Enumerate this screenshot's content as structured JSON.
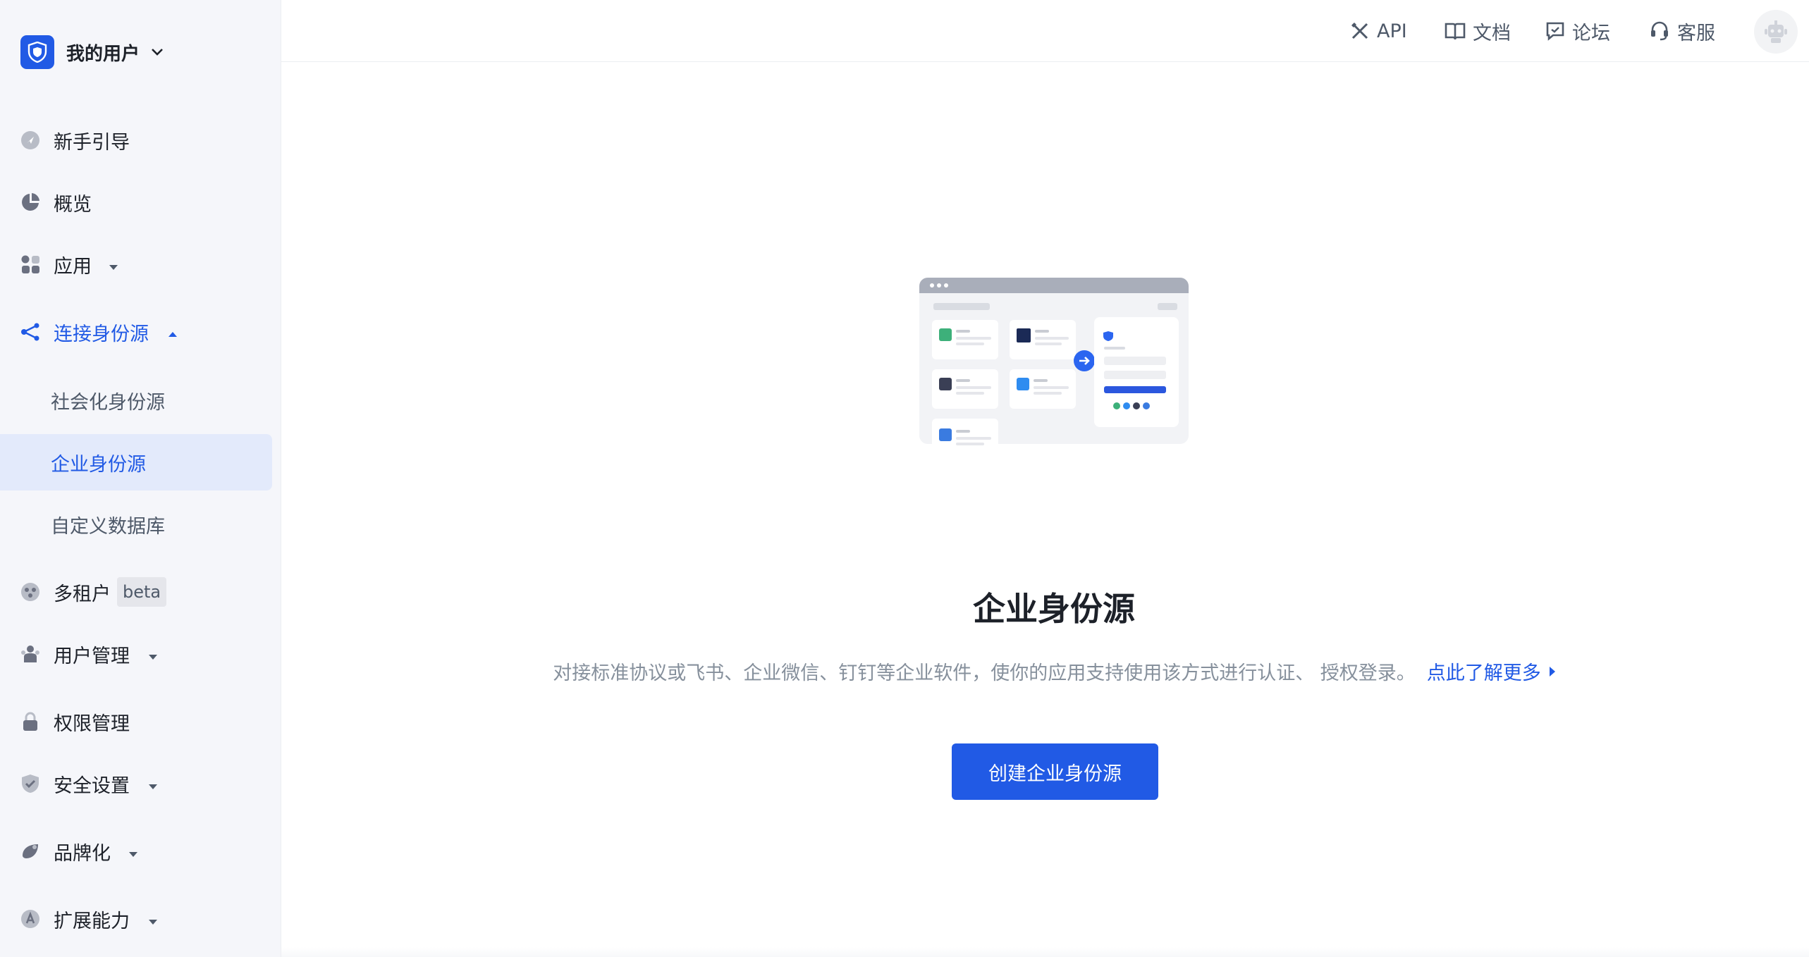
{
  "brand": {
    "name": "我的用户"
  },
  "sidebar": {
    "items": [
      {
        "label": "新手引导",
        "icon": "rocket-icon"
      },
      {
        "label": "概览",
        "icon": "pie-chart-icon"
      },
      {
        "label": "应用",
        "icon": "apps-icon",
        "expandable": true
      },
      {
        "label": "连接身份源",
        "icon": "share-icon",
        "expanded": true,
        "children": [
          {
            "label": "社会化身份源"
          },
          {
            "label": "企业身份源",
            "selected": true
          },
          {
            "label": "自定义数据库"
          }
        ]
      },
      {
        "label": "多租户",
        "icon": "tenant-icon",
        "badge": "beta"
      },
      {
        "label": "用户管理",
        "icon": "users-icon",
        "expandable": true
      },
      {
        "label": "权限管理",
        "icon": "lock-icon"
      },
      {
        "label": "安全设置",
        "icon": "shield-icon",
        "expandable": true
      },
      {
        "label": "品牌化",
        "icon": "brand-icon",
        "expandable": true
      },
      {
        "label": "扩展能力",
        "icon": "extension-icon",
        "expandable": true
      }
    ]
  },
  "header": {
    "links": [
      {
        "label": "API",
        "icon": "tools-icon"
      },
      {
        "label": "文档",
        "icon": "book-icon"
      },
      {
        "label": "论坛",
        "icon": "chat-icon"
      },
      {
        "label": "客服",
        "icon": "headset-icon"
      }
    ]
  },
  "main": {
    "title": "企业身份源",
    "description": "对接标准协议或飞书、企业微信、钉钉等企业软件，使你的应用支持使用该方式进行认证、 授权登录。",
    "learn_more": "点此了解更多",
    "create_button": "创建企业身份源"
  },
  "colors": {
    "accent": "#215ae5",
    "sidebar_bg": "#f5f6fa",
    "selected_bg": "#e3eafb"
  }
}
